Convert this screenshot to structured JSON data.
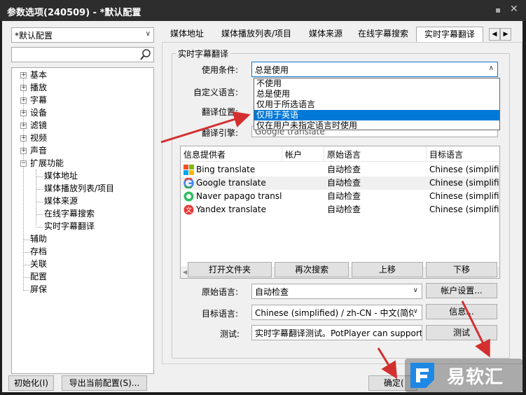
{
  "window": {
    "title": "参数选项(240509) - *默认配置",
    "pin_glyph": "▪",
    "close_glyph": "✕"
  },
  "profile": {
    "selected": "*默认配置"
  },
  "tree": {
    "items": [
      {
        "label": "基本",
        "expander": "+"
      },
      {
        "label": "播放",
        "expander": "+"
      },
      {
        "label": "字幕",
        "expander": "+"
      },
      {
        "label": "设备",
        "expander": "+"
      },
      {
        "label": "滤镜",
        "expander": "+"
      },
      {
        "label": "视频",
        "expander": "+"
      },
      {
        "label": "声音",
        "expander": "+"
      },
      {
        "label": "扩展功能",
        "expander": "−"
      },
      {
        "label": "媒体地址"
      },
      {
        "label": "媒体播放列表/项目"
      },
      {
        "label": "媒体来源"
      },
      {
        "label": "在线字幕搜索"
      },
      {
        "label": "实时字幕翻译"
      },
      {
        "label": "辅助"
      },
      {
        "label": "存档"
      },
      {
        "label": "关联"
      },
      {
        "label": "配置"
      },
      {
        "label": "屏保"
      }
    ]
  },
  "buttons": {
    "reset": "初始化(I)",
    "export": "导出当前配置(S)...",
    "ok": "确定(",
    "open_folder": "打开文件夹",
    "search_again": "再次搜索",
    "move_up": "上移",
    "move_down": "下移",
    "account_settings": "帐户设置...",
    "info": "信息...",
    "test": "测试"
  },
  "tabs": [
    "媒体地址",
    "媒体播放列表/项目",
    "媒体来源",
    "在线字幕搜索",
    "实时字幕翻译"
  ],
  "tab_scroll": {
    "left": "◀",
    "right": "▶"
  },
  "section": {
    "title": "实时字幕翻译"
  },
  "form": {
    "use_condition_label": "使用条件:",
    "use_condition_value": "总是使用",
    "custom_language_label": "自定义语言:",
    "position_label": "翻译位置:",
    "engine_label": "翻译引擎:",
    "engine_value": "Google translate",
    "source_lang_label": "原始语言:",
    "source_lang_value": "自动检查",
    "target_lang_label": "目标语言:",
    "target_lang_value": "Chinese (simplified) / zh-CN - 中文(简体",
    "test_label": "测试:",
    "test_value": "实时字幕翻译测试。PotPlayer can support c"
  },
  "dropdown": {
    "options": [
      "不使用",
      "总是使用",
      "仅用于所选语言",
      "仅用于英语",
      "仅在用户未指定语言时使用"
    ],
    "highlighted": "仅用于英语"
  },
  "provider_table": {
    "headers": [
      "信息提供者",
      "帐户",
      "原始语言",
      "目标语言"
    ],
    "rows": [
      {
        "provider": "Bing translate",
        "account": "",
        "source": "自动检查",
        "target": "Chinese (simplified",
        "icon": "bing-icon"
      },
      {
        "provider": "Google translate",
        "account": "",
        "source": "自动检查",
        "target": "Chinese (simplified",
        "icon": "google-icon"
      },
      {
        "provider": "Naver papago transla...",
        "account": "",
        "source": "自动检查",
        "target": "Chinese (simplified",
        "icon": "papago-icon"
      },
      {
        "provider": "Yandex translate",
        "account": "",
        "source": "自动检查",
        "target": "Chinese (simplified",
        "icon": "yandex-icon"
      }
    ]
  },
  "watermark": {
    "text": "易软汇"
  },
  "colors": {
    "selection": "#0078d7",
    "annotation_arrow": "#d32f2f",
    "titlebar": "#2d2d2d"
  }
}
